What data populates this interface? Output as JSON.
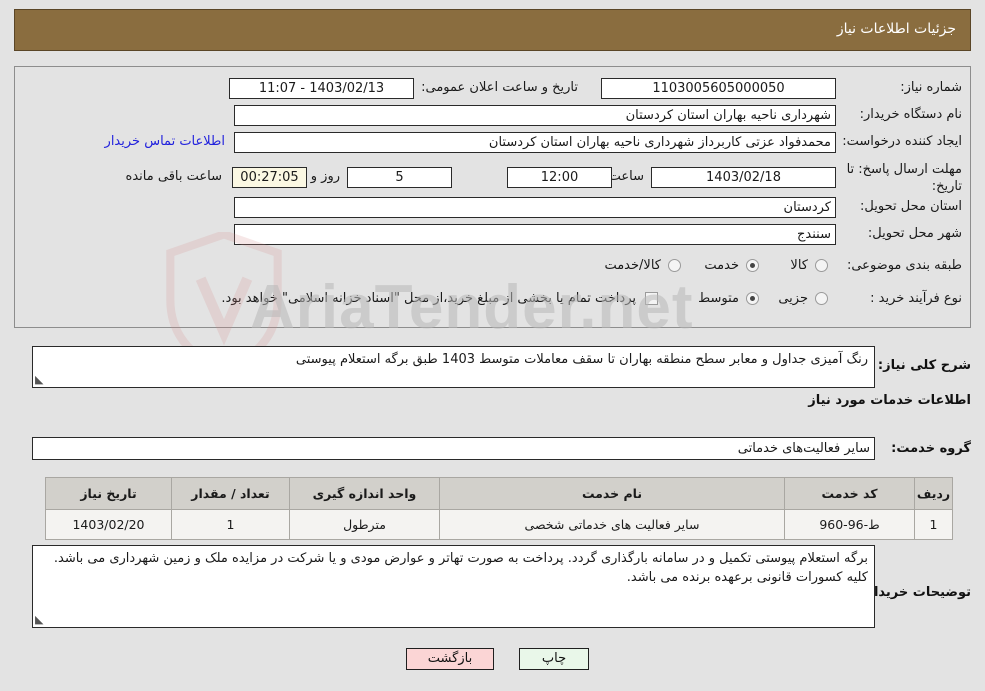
{
  "header": {
    "title": "جزئیات اطلاعات نیاز"
  },
  "watermark": {
    "text": "AriaTender.net",
    "shield": "shield-icon"
  },
  "info": {
    "labels": {
      "need_number": "شماره نیاز:",
      "buyer_org": "نام دستگاه خریدار:",
      "requester": "ایجاد کننده درخواست:",
      "deadline": "مهلت ارسال پاسخ: تا تاریخ:",
      "province": "استان محل تحویل:",
      "city": "شهر محل تحویل:",
      "category": "طبقه بندی موضوعی:",
      "purchase_type": "نوع فرآیند خرید :",
      "announce_datetime": "تاریخ و ساعت اعلان عمومی:",
      "hour": "ساعت",
      "day_and": "روز و",
      "remaining": "ساعت باقی مانده"
    },
    "values": {
      "need_number": "1103005605000050",
      "buyer_org": "شهرداری ناحیه بهاران استان کردستان",
      "requester": "محمدفواد عزتی کاربرداز شهرداری ناحیه بهاران استان کردستان",
      "deadline_date": "1403/02/18",
      "deadline_hour": "12:00",
      "days_left": "5",
      "countdown": "00:27:05",
      "province": "کردستان",
      "city": "سنندج",
      "announce_datetime": "1403/02/13 - 11:07"
    },
    "contact_link": "اطلاعات تماس خریدار",
    "category_options": [
      {
        "label": "کالا",
        "selected": false
      },
      {
        "label": "خدمت",
        "selected": true
      },
      {
        "label": "کالا/خدمت",
        "selected": false
      }
    ],
    "purchase_options": [
      {
        "label": "جزیی",
        "selected": false
      },
      {
        "label": "متوسط",
        "selected": true
      }
    ],
    "treasury_checkbox": {
      "label": "پرداخت تمام یا بخشی از مبلغ خرید،از محل \"اسناد خزانه اسلامی\" خواهد بود.",
      "checked": false
    }
  },
  "description": {
    "label": "شرح کلی نیاز:",
    "value": "رنگ آمیزی جداول و معابر سطح منطقه بهاران تا سقف معاملات متوسط  1403 طبق برگه استعلام پیوستی"
  },
  "services_section": {
    "heading": "اطلاعات خدمات مورد نیاز",
    "group_label": "گروه خدمت:",
    "group_value": "سایر فعالیت‌های خدماتی"
  },
  "table": {
    "columns": [
      "ردیف",
      "کد خدمت",
      "نام خدمت",
      "واحد اندازه گیری",
      "تعداد / مقدار",
      "تاریخ نیاز"
    ],
    "rows": [
      [
        "1",
        "ط-96-960",
        "سایر فعالیت های خدماتی شخصی",
        "مترطول",
        "1",
        "1403/02/20"
      ]
    ]
  },
  "buyer_notes": {
    "label": "توضیحات خریدار:",
    "value": "برگه استعلام پیوستی تکمیل و در سامانه بارگذاری گردد. پرداخت به صورت تهاتر و عوارض مودی و یا شرکت در مزایده ملک و زمین شهرداری می باشد. کلیه کسورات قانونی برعهده برنده می باشد."
  },
  "footer": {
    "print_label": "چاپ",
    "back_label": "بازگشت"
  },
  "colors": {
    "header_bg": "#8a6d3f",
    "page_bg": "#e3e3e3",
    "link": "#2222dd",
    "print_btn": "#e9f7e9",
    "back_btn": "#fbd5d5",
    "countdown_bg": "#fbf8e3"
  }
}
